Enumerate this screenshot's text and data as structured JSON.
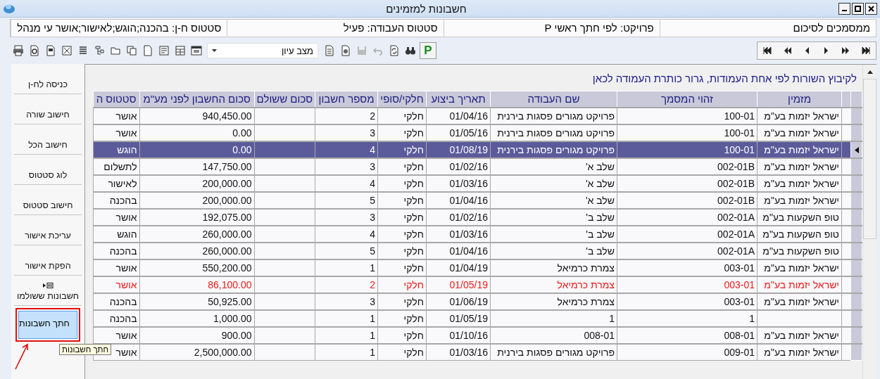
{
  "window": {
    "title": "חשבונות למזמינים"
  },
  "info_bar": [
    "ממסמכים לסיכום",
    "פרויקט: לפי חתך ראשי P",
    "סטטוס העבודה: פעיל",
    "סטטוס ח-ן: בהכנה;הוגש;לאישור;אושר עי מנהל"
  ],
  "toolbar": {
    "view_mode": "מצב עיון",
    "p_button": "P"
  },
  "side_buttons": [
    {
      "label": "כניסה לח-ן",
      "kind": "plain",
      "highlighted": false
    },
    {
      "label": "חישוב שורה",
      "kind": "plain",
      "highlighted": false
    },
    {
      "label": "חישוב הכל",
      "kind": "plain",
      "highlighted": false
    },
    {
      "label": "לוג סטטוס",
      "kind": "plain",
      "highlighted": false
    },
    {
      "label": "חישוב סטטוס",
      "kind": "plain",
      "highlighted": false
    },
    {
      "label": "עריכת אישור",
      "kind": "plain",
      "highlighted": false
    },
    {
      "label": "הפקת אישור",
      "kind": "plain",
      "highlighted": false
    },
    {
      "label": "חשבונות ששולמו",
      "kind": "icon",
      "highlighted": false
    },
    {
      "label": "חתך חשבונות",
      "kind": "plain",
      "highlighted": true
    }
  ],
  "tooltip": "חתך חשבונות",
  "group_hint": "לקיבוץ השורות לפי אחת העמודות, גרור כותרת העמודה לכאן",
  "table": {
    "columns": [
      "מזמין",
      "זהוי המסמך",
      "שם העבודה",
      "תאריך ביצוע",
      "חלקי/סופי",
      "מספר חשבון",
      "סכום ששולם",
      "סכום החשבון לפני מע\"מ",
      "סטטוס ה"
    ],
    "rows": [
      {
        "cells": [
          "ישראל יזמות בע\"מ",
          "100-01",
          "פרויקט מגורים פסגות בירנית",
          "01/04/16",
          "חלקי",
          "2",
          "",
          "940,450.00",
          "אושר"
        ],
        "selected": false,
        "flagged": false
      },
      {
        "cells": [
          "ישראל יזמות בע\"מ",
          "100-01",
          "פרויקט מגורים פסגות בירנית",
          "01/05/16",
          "חלקי",
          "3",
          "",
          "0.00",
          "אושר"
        ],
        "selected": false,
        "flagged": false
      },
      {
        "cells": [
          "ישראל יזמות בע\"מ",
          "100-01",
          "פרויקט מגורים פסגות בירנית",
          "01/08/19",
          "חלקי",
          "4",
          "",
          "0.00",
          "הוגש"
        ],
        "selected": true,
        "flagged": false
      },
      {
        "cells": [
          "ישראל יזמות בע\"מ",
          "002-01B",
          "שלב א'",
          "01/02/16",
          "חלקי",
          "3",
          "",
          "147,750.00",
          "לתשלום"
        ],
        "selected": false,
        "flagged": false
      },
      {
        "cells": [
          "ישראל יזמות בע\"מ",
          "002-01B",
          "שלב א'",
          "01/03/16",
          "חלקי",
          "4",
          "",
          "200,000.00",
          "לאישור"
        ],
        "selected": false,
        "flagged": false
      },
      {
        "cells": [
          "ישראל יזמות בע\"מ",
          "002-01B",
          "שלב א'",
          "01/04/16",
          "חלקי",
          "5",
          "",
          "200,000.00",
          "בהכנה"
        ],
        "selected": false,
        "flagged": false
      },
      {
        "cells": [
          "טופ השקעות בע\"מ",
          "002-01A",
          "שלב ב'",
          "01/02/16",
          "חלקי",
          "3",
          "",
          "192,075.00",
          "אושר"
        ],
        "selected": false,
        "flagged": false
      },
      {
        "cells": [
          "טופ השקעות בע\"מ",
          "002-01A",
          "שלב ב'",
          "01/03/16",
          "חלקי",
          "4",
          "",
          "260,000.00",
          "הוגש"
        ],
        "selected": false,
        "flagged": false
      },
      {
        "cells": [
          "טופ השקעות בע\"מ",
          "002-01A",
          "שלב ב'",
          "01/04/16",
          "חלקי",
          "5",
          "",
          "260,000.00",
          "בהכנה"
        ],
        "selected": false,
        "flagged": false
      },
      {
        "cells": [
          "ישראל יזמות בע\"מ",
          "003-01",
          "צמרת כרמיאל",
          "01/04/19",
          "חלקי",
          "1",
          "",
          "550,200.00",
          "אושר"
        ],
        "selected": false,
        "flagged": false
      },
      {
        "cells": [
          "ישראל יזמות בע\"מ",
          "003-01",
          "צמרת כרמיאל",
          "01/05/19",
          "חלקי",
          "2",
          "",
          "86,100.00",
          "אושר"
        ],
        "selected": false,
        "flagged": true
      },
      {
        "cells": [
          "ישראל יזמות בע\"מ",
          "003-01",
          "צמרת כרמיאל",
          "01/06/19",
          "חלקי",
          "3",
          "",
          "50,925.00",
          "בהכנה"
        ],
        "selected": false,
        "flagged": false
      },
      {
        "cells": [
          "",
          "1",
          "1",
          "01/05/19",
          "חלקי",
          "1",
          "",
          "1,000.00",
          "בהכנה"
        ],
        "selected": false,
        "flagged": false
      },
      {
        "cells": [
          "ישראל יזמות בע\"מ",
          "008-01",
          "008-01",
          "01/10/16",
          "חלקי",
          "1",
          "",
          "900.00",
          "אושר"
        ],
        "selected": false,
        "flagged": false
      },
      {
        "cells": [
          "ישראל יזמות בע\"מ",
          "009-01",
          "פרויקט מגורים פסגות בירנית",
          "01/03/16",
          "חלקי",
          "1",
          "",
          "2,500,000.00",
          "אושר"
        ],
        "selected": false,
        "flagged": false
      }
    ]
  }
}
